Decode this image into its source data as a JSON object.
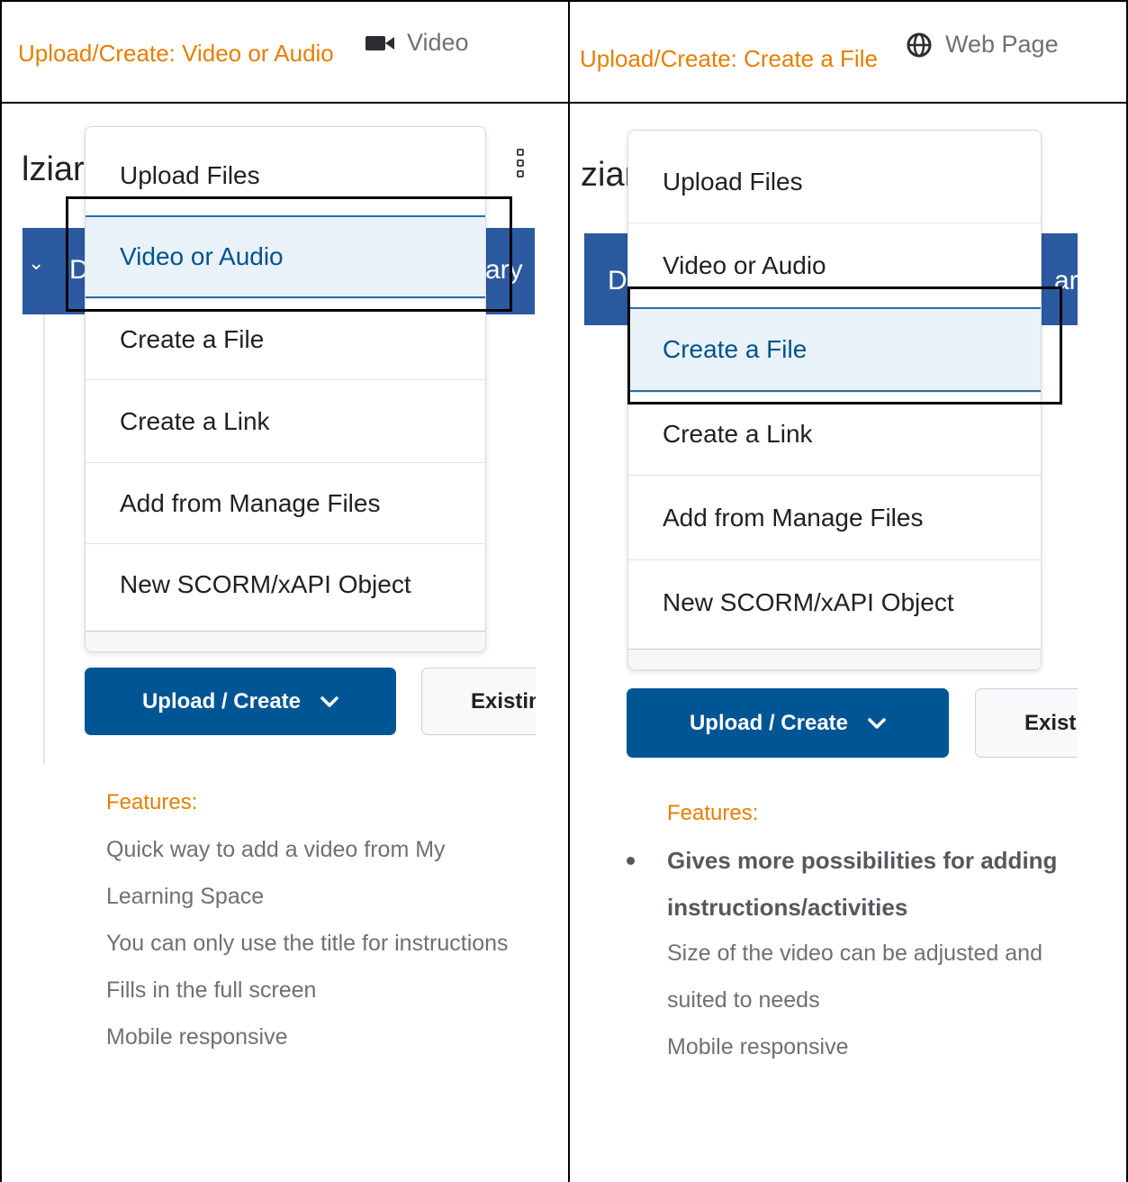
{
  "left": {
    "header_title": "Upload/Create: Video or Audio",
    "header_type_icon": "video-camera-icon",
    "header_type_label": "Video",
    "bg_title": "lziar",
    "bg_bar_left": "D",
    "bg_bar_right": "ary",
    "menu_items": [
      "Upload Files",
      "Video or Audio",
      "Create a File",
      "Create a Link",
      "Add from Manage Files",
      "New SCORM/xAPI Object"
    ],
    "active_item": "Video or Audio",
    "primary_button": "Upload / Create",
    "secondary_button": "Existing",
    "features_label": "Features:",
    "features": [
      "Quick way to add a video from My",
      "Learning Space",
      "You can only use the title for instructions",
      "Fills in the full screen",
      "Mobile responsive"
    ]
  },
  "right": {
    "header_title": "Upload/Create: Create a File",
    "header_type_icon": "globe-icon",
    "header_type_label": "Web Page",
    "bg_title": "ziar",
    "bg_bar_left": "D",
    "bg_bar_right": "ary",
    "menu_items": [
      "Upload Files",
      "Video or Audio",
      "Create a File",
      "Create a Link",
      "Add from Manage Files",
      "New SCORM/xAPI Object"
    ],
    "active_item": "Create a File",
    "primary_button": "Upload / Create",
    "secondary_button": "Existing",
    "features_label": "Features:",
    "features_bold": [
      "Gives more possibilities for adding",
      "instructions/activities"
    ],
    "features": [
      "Size of the video can be adjusted and",
      "suited to needs",
      "Mobile responsive"
    ]
  },
  "colors": {
    "header_orange": "#e67e00",
    "primary_blue": "#005594",
    "active_text": "#00538a",
    "active_bg": "#e8f2f8",
    "bar_blue": "#2c5aa0"
  }
}
